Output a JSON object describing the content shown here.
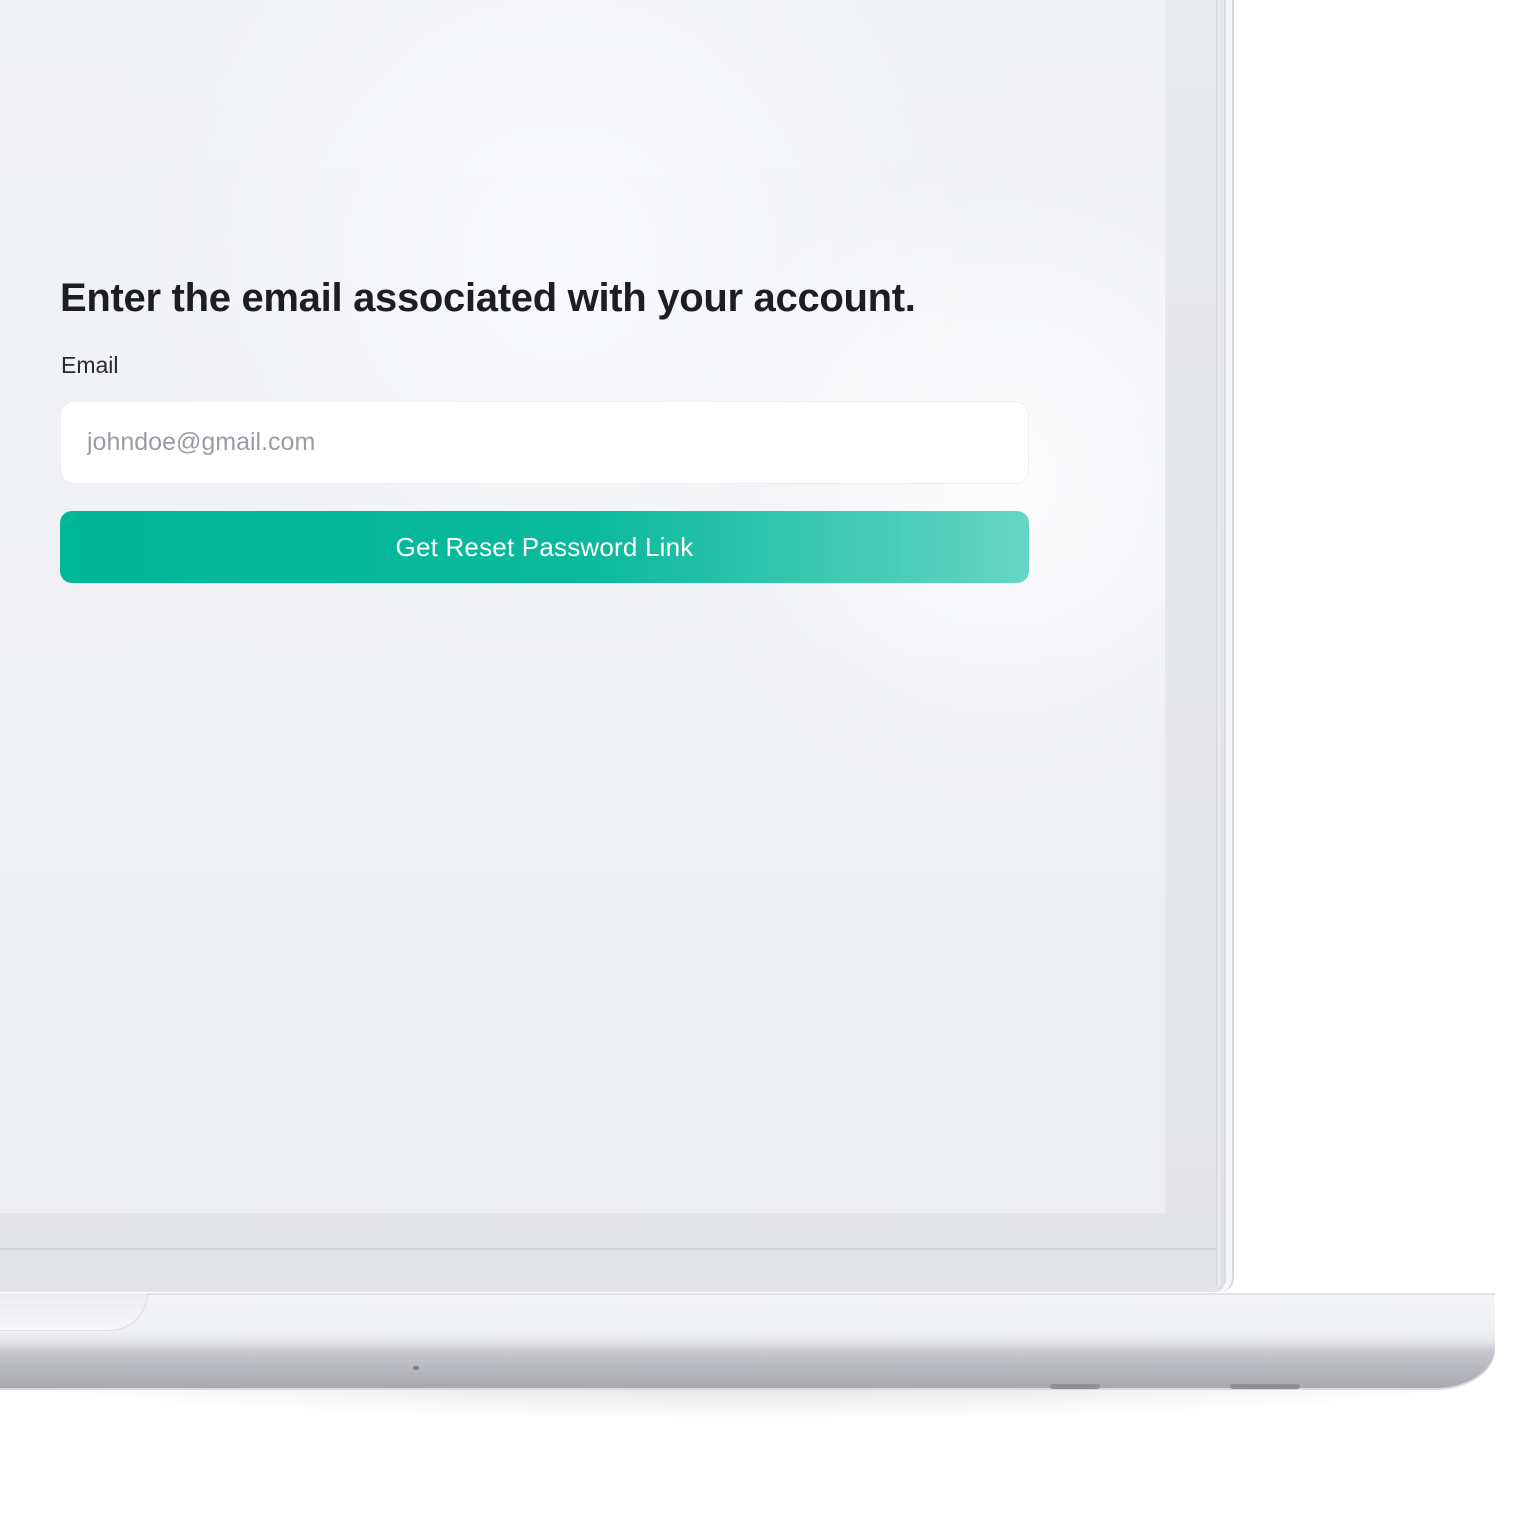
{
  "form": {
    "title": "Enter the email associated with your account.",
    "email_label": "Email",
    "email_placeholder": "johndoe@gmail.com",
    "email_value": "",
    "submit_label": "Get Reset Password Link"
  },
  "colors": {
    "button_start": "#00b798",
    "button_end": "#66d6c4",
    "screen_background": "#f0f1f5",
    "title_text": "#1d1e22",
    "placeholder_text": "#9b9ca3"
  }
}
